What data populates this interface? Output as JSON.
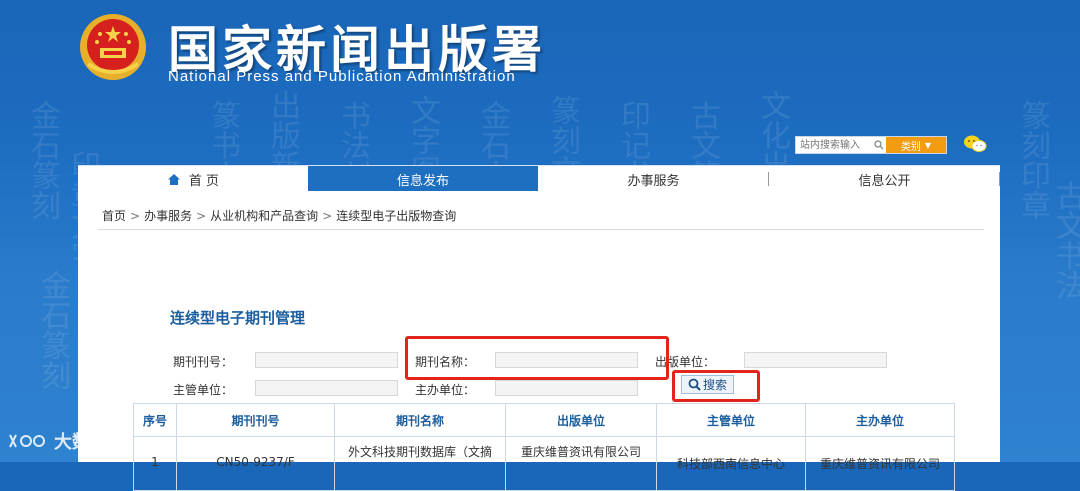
{
  "header": {
    "title": "国家新闻出版署",
    "subtitle": "National  Press and Publication Administration"
  },
  "search": {
    "placeholder": "站内搜索输入",
    "category_label": "类别"
  },
  "nav": {
    "items": [
      {
        "label": "首 页"
      },
      {
        "label": "信息发布"
      },
      {
        "label": "办事服务"
      },
      {
        "label": "信息公开"
      }
    ]
  },
  "breadcrumb": {
    "items": [
      "首页",
      "办事服务",
      "从业机构和产品查询",
      "连续型电子出版物查询"
    ],
    "separator": ">"
  },
  "form": {
    "title": "连续型电子期刊管理",
    "fields": {
      "issue_number": {
        "label": "期刊刊号：",
        "value": ""
      },
      "journal_name": {
        "label": "期刊名称：",
        "value": ""
      },
      "publisher": {
        "label": "出版单位：",
        "value": ""
      },
      "supervisor": {
        "label": "主管单位：",
        "value": ""
      },
      "sponsor": {
        "label": "主办单位：",
        "value": ""
      }
    },
    "search_button": "搜索"
  },
  "table": {
    "headers": [
      "序号",
      "期刊刊号",
      "期刊名称",
      "出版单位",
      "主管单位",
      "主办单位"
    ],
    "rows": [
      [
        "1",
        "CN50-9237/F",
        "外文科技期刊数据库（文摘",
        "重庆维普资讯有限公司",
        "科技部西南信息中心",
        "重庆维普资讯有限公司"
      ]
    ]
  },
  "watermark": {
    "text": "大数跨境"
  },
  "colors": {
    "brand_blue": "#1e6fc0",
    "title_blue": "#1d5e9e",
    "highlight_red": "#e3241b",
    "category_orange": "#f39c12"
  }
}
